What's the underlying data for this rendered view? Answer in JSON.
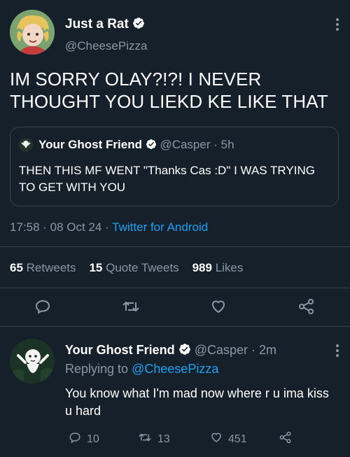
{
  "main_tweet": {
    "display_name": "Just a Rat",
    "handle": "@CheesePizza",
    "text": "IM SORRY OLAY?!?! I NEVER THOUGHT YOU LIEKD KE LIKE THAT",
    "quote": {
      "display_name": "Your Ghost Friend",
      "handle": "@Casper",
      "separator": "·",
      "time": "5h",
      "text": "THEN THIS MF WENT \"Thanks Cas :D\" I WAS TRYING TO GET WITH YOU"
    },
    "timestamp": "17:58 · 08 Oct 24 · ",
    "source": "Twitter for Android",
    "stats": {
      "retweets_count": "65",
      "retweets_label": "Retweets",
      "quotes_count": "15",
      "quotes_label": "Quote Tweets",
      "likes_count": "989",
      "likes_label": "Likes"
    }
  },
  "reply": {
    "display_name": "Your Ghost Friend",
    "handle": "@Casper",
    "separator": "·",
    "time": "2m",
    "replying_prefix": "Replying to ",
    "replying_handle": "@CheesePizza",
    "text": "You know what I'm mad now where r u ima kiss u hard",
    "replies": "10",
    "retweets": "13",
    "likes": "451"
  },
  "colors": {
    "background": "#15202b",
    "secondary_text": "#8899a6",
    "link": "#1da1f2",
    "verified": "#ffffff",
    "divider": "#38444d"
  }
}
